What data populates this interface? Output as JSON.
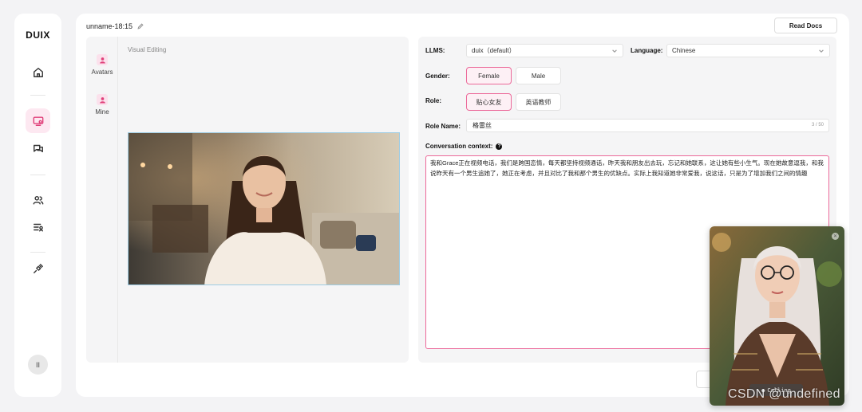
{
  "app": {
    "logo": "DUIX"
  },
  "rail": {
    "items": [
      "home-icon",
      "screen-avatar-icon",
      "chat-icon",
      "users-icon",
      "list-user-icon",
      "plugin-icon"
    ],
    "avatar": "II"
  },
  "header": {
    "project_name": "unname-18:15",
    "read_docs": "Read Docs"
  },
  "editor": {
    "tabs": [
      {
        "label": "Avatars"
      },
      {
        "label": "Mine"
      }
    ],
    "visual_label": "Visual Editing"
  },
  "settings": {
    "llms_label": "LLMS:",
    "llms_value": "duix（default）",
    "language_label": "Language:",
    "language_value": "Chinese",
    "gender_label": "Gender:",
    "gender_options": [
      "Female",
      "Male"
    ],
    "gender_selected": "Female",
    "role_label": "Role:",
    "role_options": [
      "贴心女友",
      "英语教师"
    ],
    "role_selected": "贴心女友",
    "role_name_label": "Role Name:",
    "role_name_value": "格雷丝",
    "role_name_count": "3 / 50",
    "context_label": "Conversation context:",
    "context_value": "我和Grace正在视频电话，我们是跨国恋情，每天都坚持视频通话，昨天我和朋友出去玩，忘记和她联系，这让她有些小生气。现在她故意逗我，和我说昨天有一个男生追她了，她正在考虑，并且对比了我和那个男生的优缺点。实际上我知道她非常爱我，说这话，只是为了增加我们之间的情趣"
  },
  "call": {
    "button_label": "Calling"
  },
  "watermark": "CSDN @undefined",
  "colors": {
    "accent": "#e0407a",
    "accent_border": "#ec6a9a",
    "accent_bg": "#fde8f1"
  }
}
